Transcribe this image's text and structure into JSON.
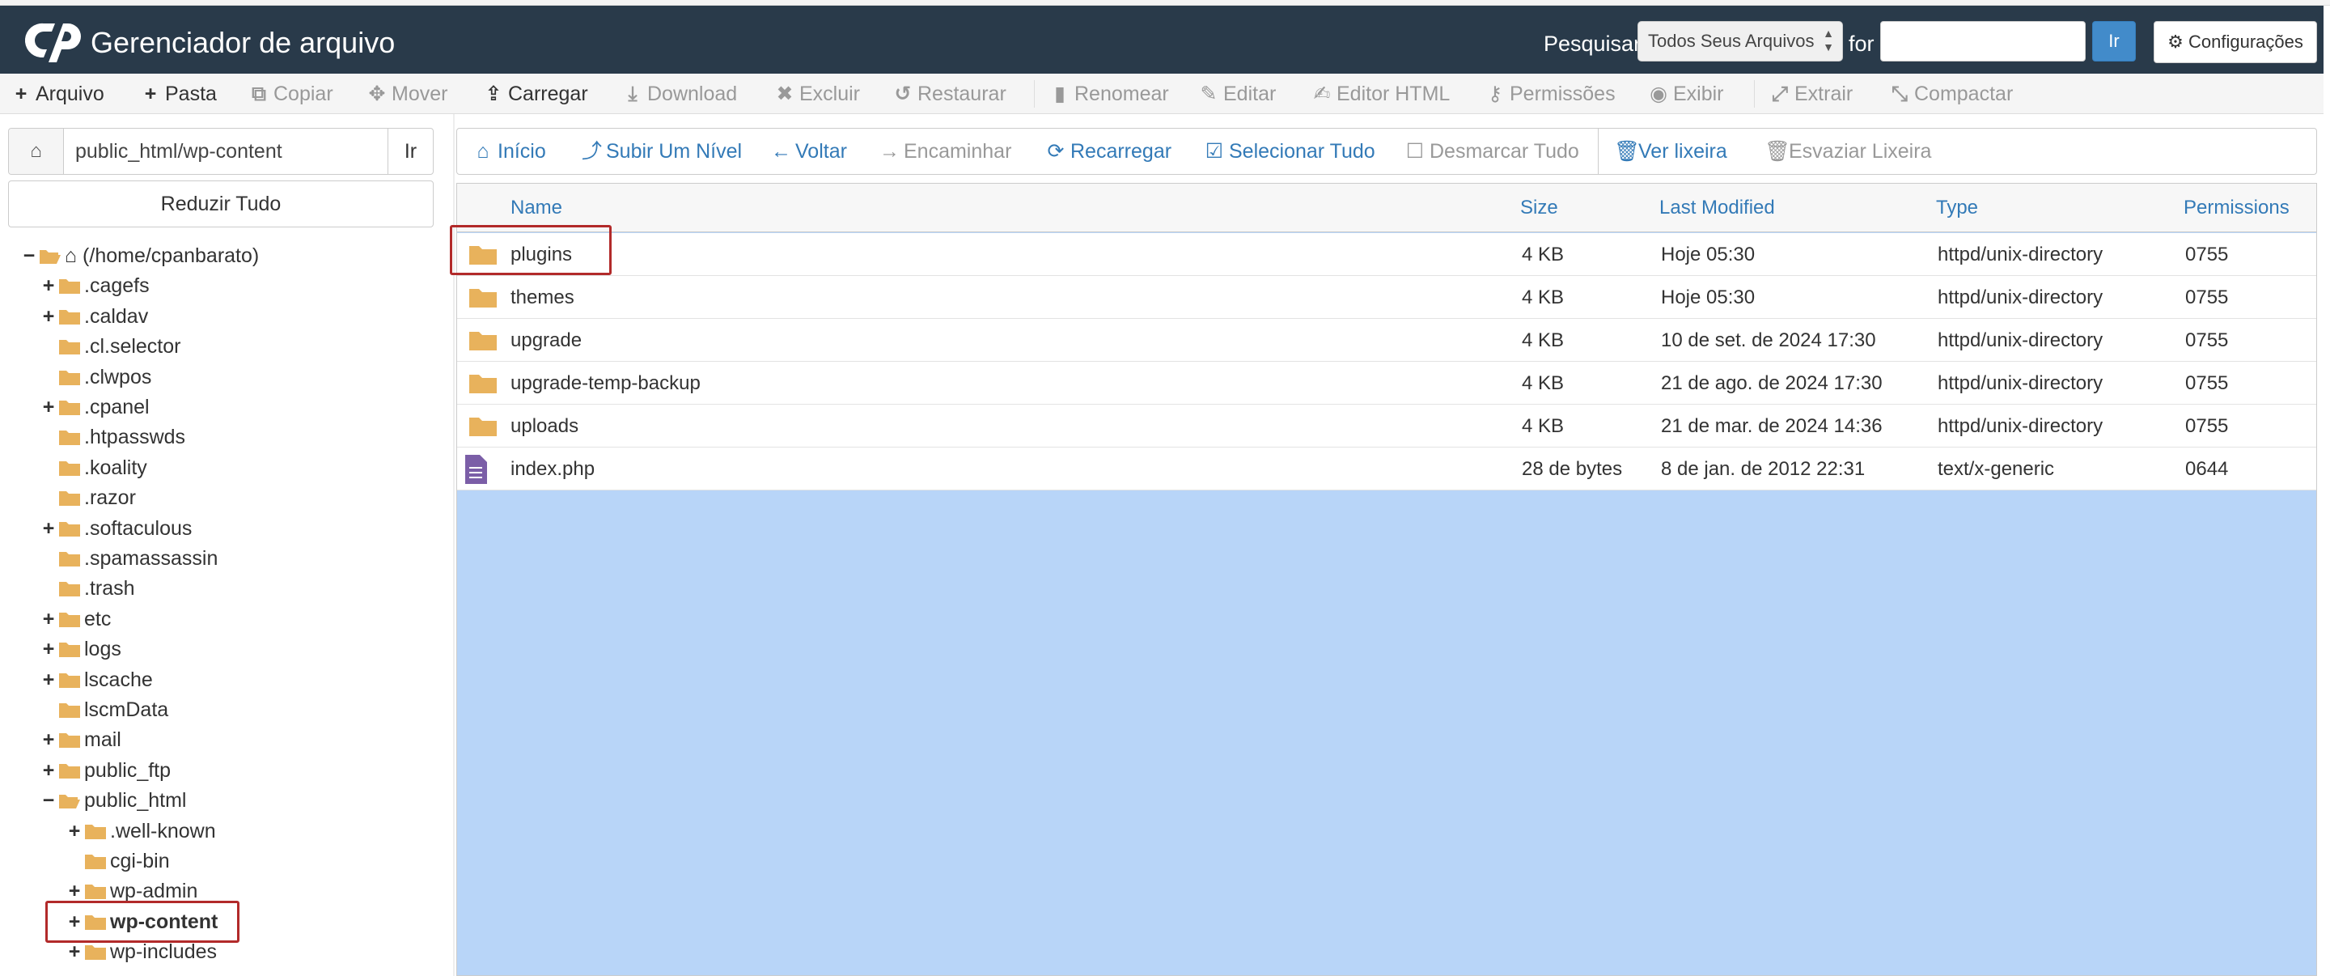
{
  "header": {
    "title": "Gerenciador de arquivo",
    "search_label": "Pesquisar",
    "search_scope": "Todos Seus Arquivos",
    "for_label": "for",
    "search_value": "",
    "go_label": "Ir",
    "settings_label": "Configurações"
  },
  "toolbar": {
    "items": [
      {
        "label": "Arquivo",
        "icon": "plus-icon",
        "enabled": true
      },
      {
        "label": "Pasta",
        "icon": "plus-icon",
        "enabled": true
      },
      {
        "label": "Copiar",
        "icon": "copy-icon",
        "enabled": false
      },
      {
        "label": "Mover",
        "icon": "move-icon",
        "enabled": false
      },
      {
        "label": "Carregar",
        "icon": "upload-icon",
        "enabled": true
      },
      {
        "label": "Download",
        "icon": "download-icon",
        "enabled": false
      },
      {
        "label": "Excluir",
        "icon": "close-icon",
        "enabled": false
      },
      {
        "label": "Restaurar",
        "icon": "undo-icon",
        "enabled": false
      },
      {
        "label": "Renomear",
        "icon": "file-icon",
        "enabled": false
      },
      {
        "label": "Editar",
        "icon": "pencil-icon",
        "enabled": false
      },
      {
        "label": "Editor HTML",
        "icon": "edit-icon",
        "enabled": false
      },
      {
        "label": "Permissões",
        "icon": "key-icon",
        "enabled": false
      },
      {
        "label": "Exibir",
        "icon": "eye-icon",
        "enabled": false
      },
      {
        "label": "Extrair",
        "icon": "expand-icon",
        "enabled": false
      },
      {
        "label": "Compactar",
        "icon": "compress-icon",
        "enabled": false
      }
    ]
  },
  "left": {
    "path_value": "public_html/wp-content",
    "go_label": "Ir",
    "collapse_label": "Reduzir Tudo",
    "tree": [
      {
        "label": "(/home/cpanbarato)",
        "toggle": "−",
        "level": 0,
        "home": true
      },
      {
        "label": ".cagefs",
        "toggle": "+",
        "level": 1
      },
      {
        "label": ".caldav",
        "toggle": "+",
        "level": 1
      },
      {
        "label": ".cl.selector",
        "toggle": "",
        "level": 1
      },
      {
        "label": ".clwpos",
        "toggle": "",
        "level": 1
      },
      {
        "label": ".cpanel",
        "toggle": "+",
        "level": 1
      },
      {
        "label": ".htpasswds",
        "toggle": "",
        "level": 1
      },
      {
        "label": ".koality",
        "toggle": "",
        "level": 1
      },
      {
        "label": ".razor",
        "toggle": "",
        "level": 1
      },
      {
        "label": ".softaculous",
        "toggle": "+",
        "level": 1
      },
      {
        "label": ".spamassassin",
        "toggle": "",
        "level": 1
      },
      {
        "label": ".trash",
        "toggle": "",
        "level": 1
      },
      {
        "label": "etc",
        "toggle": "+",
        "level": 1
      },
      {
        "label": "logs",
        "toggle": "+",
        "level": 1
      },
      {
        "label": "lscache",
        "toggle": "+",
        "level": 1
      },
      {
        "label": "lscmData",
        "toggle": "",
        "level": 1
      },
      {
        "label": "mail",
        "toggle": "+",
        "level": 1
      },
      {
        "label": "public_ftp",
        "toggle": "+",
        "level": 1
      },
      {
        "label": "public_html",
        "toggle": "−",
        "level": 1,
        "open": true
      },
      {
        "label": ".well-known",
        "toggle": "+",
        "level": 2
      },
      {
        "label": "cgi-bin",
        "toggle": "",
        "level": 2
      },
      {
        "label": "wp-admin",
        "toggle": "+",
        "level": 2
      },
      {
        "label": "wp-content",
        "toggle": "+",
        "level": 2,
        "selected": true
      },
      {
        "label": "wp-includes",
        "toggle": "+",
        "level": 2
      }
    ]
  },
  "nav": {
    "items": [
      {
        "label": "Início",
        "icon": "home-icon",
        "enabled": true
      },
      {
        "label": "Subir Um Nível",
        "icon": "level-up-icon",
        "enabled": true
      },
      {
        "label": "Voltar",
        "icon": "arrow-left-icon",
        "enabled": true
      },
      {
        "label": "Encaminhar",
        "icon": "arrow-right-icon",
        "enabled": false
      },
      {
        "label": "Recarregar",
        "icon": "refresh-icon",
        "enabled": true
      },
      {
        "label": "Selecionar Tudo",
        "icon": "checkbox-checked-icon",
        "enabled": true
      },
      {
        "label": "Desmarcar Tudo",
        "icon": "checkbox-empty-icon",
        "enabled": false
      },
      {
        "label": "Ver lixeira",
        "icon": "trash-icon",
        "enabled": true
      },
      {
        "label": "Esvaziar Lixeira",
        "icon": "trash-icon",
        "enabled": false
      }
    ]
  },
  "table": {
    "headers": {
      "name": "Name",
      "size": "Size",
      "modified": "Last Modified",
      "type": "Type",
      "perms": "Permissions"
    },
    "rows": [
      {
        "kind": "folder",
        "name": "plugins",
        "size": "4 KB",
        "modified": "Hoje 05:30",
        "type": "httpd/unix-directory",
        "perms": "0755",
        "highlight": true
      },
      {
        "kind": "folder",
        "name": "themes",
        "size": "4 KB",
        "modified": "Hoje 05:30",
        "type": "httpd/unix-directory",
        "perms": "0755"
      },
      {
        "kind": "folder",
        "name": "upgrade",
        "size": "4 KB",
        "modified": "10 de set. de 2024 17:30",
        "type": "httpd/unix-directory",
        "perms": "0755"
      },
      {
        "kind": "folder",
        "name": "upgrade-temp-backup",
        "size": "4 KB",
        "modified": "21 de ago. de 2024 17:30",
        "type": "httpd/unix-directory",
        "perms": "0755"
      },
      {
        "kind": "folder",
        "name": "uploads",
        "size": "4 KB",
        "modified": "21 de mar. de 2024 14:36",
        "type": "httpd/unix-directory",
        "perms": "0755"
      },
      {
        "kind": "file",
        "name": "index.php",
        "size": "28 de bytes",
        "modified": "8 de jan. de 2012 22:31",
        "type": "text/x-generic",
        "perms": "0644"
      }
    ]
  },
  "colors": {
    "header_bg": "#293a4a",
    "folder": "#e8b25c",
    "file": "#7b5ea7",
    "link": "#337ab7",
    "highlight": "#b22a2a",
    "selection_bg": "#b8d5f8"
  }
}
